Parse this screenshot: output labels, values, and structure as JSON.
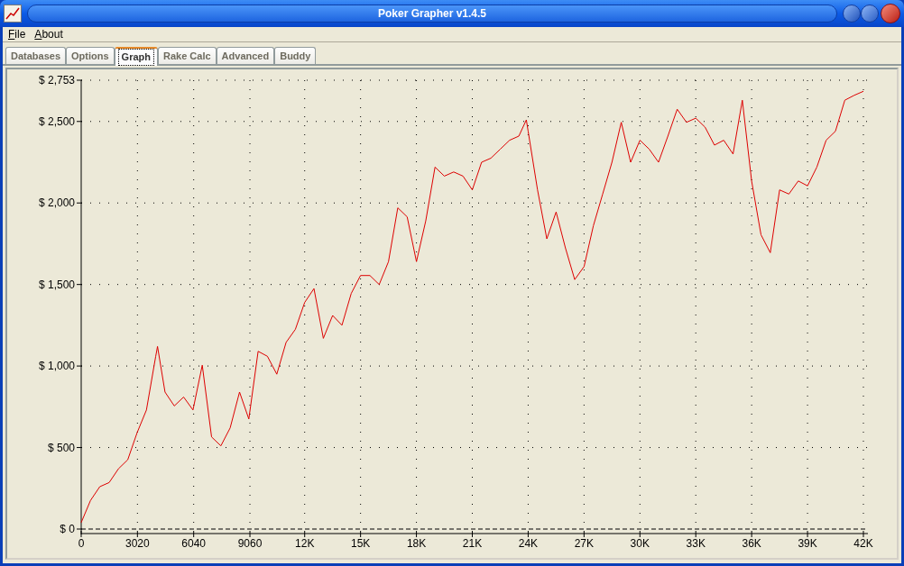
{
  "window": {
    "title": "Poker Grapher v1.4.5"
  },
  "menu": [
    {
      "label": "File"
    },
    {
      "label": "About"
    }
  ],
  "tabs": [
    {
      "label": "Databases",
      "selected": false
    },
    {
      "label": "Options",
      "selected": false
    },
    {
      "label": "Graph",
      "selected": true
    },
    {
      "label": "Rake Calc",
      "selected": false
    },
    {
      "label": "Advanced",
      "selected": false
    },
    {
      "label": "Buddy",
      "selected": false
    }
  ],
  "graph": {
    "chart_data": {
      "type": "line",
      "x": [
        0,
        500,
        1000,
        1500,
        2000,
        2500,
        3000,
        3500,
        4000,
        4100,
        4500,
        5000,
        5500,
        6000,
        6500,
        7000,
        7500,
        8000,
        8500,
        9000,
        9500,
        10000,
        10500,
        11000,
        11500,
        12000,
        12500,
        13000,
        13500,
        14000,
        14500,
        15000,
        15500,
        16000,
        16500,
        17000,
        17500,
        18000,
        18500,
        19000,
        19500,
        20000,
        20500,
        21000,
        21500,
        22000,
        22500,
        23000,
        23500,
        23900,
        24000,
        24500,
        25000,
        25500,
        26000,
        26500,
        27000,
        27500,
        28000,
        28500,
        29000,
        29500,
        30000,
        30500,
        31000,
        31500,
        32000,
        32500,
        33000,
        33500,
        34000,
        34500,
        35000,
        35500,
        36000,
        36500,
        37000,
        37500,
        38000,
        38500,
        39000,
        39500,
        40000,
        40500,
        41000,
        41500,
        42000
      ],
      "grid": true,
      "series": [
        {
          "color": "#dd0000",
          "values": [
            40,
            175,
            260,
            285,
            370,
            425,
            590,
            730,
            1060,
            1120,
            840,
            755,
            810,
            730,
            1005,
            565,
            510,
            620,
            840,
            675,
            1090,
            1060,
            950,
            1145,
            1225,
            1390,
            1475,
            1170,
            1310,
            1250,
            1445,
            1555,
            1555,
            1500,
            1640,
            1970,
            1915,
            1640,
            1890,
            2220,
            2165,
            2190,
            2165,
            2080,
            2250,
            2275,
            2330,
            2385,
            2410,
            2510,
            2440,
            2080,
            1780,
            1945,
            1725,
            1530,
            1610,
            1860,
            2055,
            2250,
            2495,
            2250,
            2385,
            2330,
            2250,
            2410,
            2575,
            2495,
            2520,
            2465,
            2355,
            2385,
            2300,
            2630,
            2135,
            1805,
            1695,
            2080,
            2055,
            2135,
            2105,
            2220,
            2385,
            2440,
            2630,
            2660,
            2685
          ]
        }
      ],
      "xlim": [
        0,
        42000
      ],
      "ylim": [
        0,
        2753
      ],
      "xticks": [
        0,
        3020,
        6040,
        9060,
        {
          "value": 12000,
          "label": "12K"
        },
        {
          "value": 15000,
          "label": "15K"
        },
        {
          "value": 18000,
          "label": "18K"
        },
        {
          "value": 21000,
          "label": "21K"
        },
        {
          "value": 24000,
          "label": "24K"
        },
        {
          "value": 27000,
          "label": "27K"
        },
        {
          "value": 30000,
          "label": "30K"
        },
        {
          "value": 33000,
          "label": "33K"
        },
        {
          "value": 36000,
          "label": "36K"
        },
        {
          "value": 39000,
          "label": "39K"
        },
        {
          "value": 42000,
          "label": "42K"
        }
      ],
      "yticks": [
        {
          "value": 0,
          "label": "$ 0"
        },
        {
          "value": 500,
          "label": "$ 500"
        },
        {
          "value": 1000,
          "label": "$ 1,000"
        },
        {
          "value": 1500,
          "label": "$ 1,500"
        },
        {
          "value": 2000,
          "label": "$ 2,000"
        },
        {
          "value": 2500,
          "label": "$ 2,500"
        },
        {
          "value": 2753,
          "label": "$ 2,753"
        }
      ]
    }
  }
}
